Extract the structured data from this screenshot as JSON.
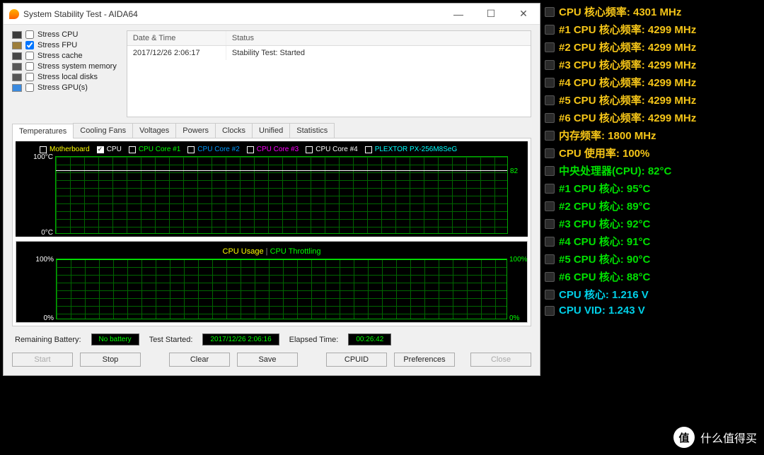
{
  "window": {
    "title": "System Stability Test - AIDA64",
    "minimize": "—",
    "maximize": "☐",
    "close": "✕"
  },
  "stress": {
    "cpu": "Stress CPU",
    "fpu": "Stress FPU",
    "cache": "Stress cache",
    "mem": "Stress system memory",
    "disk": "Stress local disks",
    "gpu": "Stress GPU(s)"
  },
  "status_table": {
    "h_date": "Date & Time",
    "h_status": "Status",
    "r_date": "2017/12/26 2:06:17",
    "r_status": "Stability Test: Started"
  },
  "tabs": [
    "Temperatures",
    "Cooling Fans",
    "Voltages",
    "Powers",
    "Clocks",
    "Unified",
    "Statistics"
  ],
  "temp_legend": {
    "mb": {
      "label": "Motherboard",
      "color": "#ff0",
      "checked": false
    },
    "cpu": {
      "label": "CPU",
      "color": "#fff",
      "checked": true
    },
    "c1": {
      "label": "CPU Core #1",
      "color": "#0f0",
      "checked": false
    },
    "c2": {
      "label": "CPU Core #2",
      "color": "#09f",
      "checked": false
    },
    "c3": {
      "label": "CPU Core #3",
      "color": "#f0f",
      "checked": false
    },
    "c4": {
      "label": "CPU Core #4",
      "color": "#fff",
      "checked": false
    },
    "ssd": {
      "label": "PLEXTOR PX-256M8SeG",
      "color": "#0ff",
      "checked": false
    }
  },
  "temp_chart": {
    "ymax": "100°C",
    "ymin": "0°C",
    "reading": "82"
  },
  "usage_title": {
    "a": "CPU Usage",
    "sep": "|",
    "b": "CPU Throttling"
  },
  "usage_chart": {
    "ymax": "100%",
    "ymin": "0%",
    "rmax": "100%",
    "rmin": "0%"
  },
  "statusbar": {
    "battery_lbl": "Remaining Battery:",
    "battery_val": "No battery",
    "started_lbl": "Test Started:",
    "started_val": "2017/12/26 2:06:16",
    "elapsed_lbl": "Elapsed Time:",
    "elapsed_val": "00:26:42"
  },
  "buttons": {
    "start": "Start",
    "stop": "Stop",
    "clear": "Clear",
    "save": "Save",
    "cpuid": "CPUID",
    "prefs": "Preferences",
    "close": "Close"
  },
  "gadget": {
    "cpu_core": "CPU 核心频率: 4301 MHz",
    "c1": "#1 CPU 核心频率: 4299 MHz",
    "c2": "#2 CPU 核心频率: 4299 MHz",
    "c3": "#3 CPU 核心频率: 4299 MHz",
    "c4": "#4 CPU 核心频率: 4299 MHz",
    "c5": "#5 CPU 核心频率: 4299 MHz",
    "c6": "#6 CPU 核心频率: 4299 MHz",
    "mem": "内存频率: 1800 MHz",
    "usage": "CPU 使用率: 100%",
    "cpu_temp": "中央处理器(CPU): 82°C",
    "t1": "#1 CPU 核心: 95°C",
    "t2": "#2 CPU 核心: 89°C",
    "t3": "#3 CPU 核心: 92°C",
    "t4": "#4 CPU 核心: 91°C",
    "t5": "#5 CPU 核心: 90°C",
    "t6": "#6 CPU 核心: 88°C",
    "vcore": "CPU 核心: 1.216 V",
    "vid": "CPU VID: 1.243 V"
  },
  "watermark": {
    "icon": "值",
    "text": "什么值得买"
  },
  "chart_data": {
    "type": "line",
    "title": "CPU Temperature",
    "ylabel": "°C",
    "ylim": [
      0,
      100
    ],
    "series": [
      {
        "name": "CPU",
        "values": [
          82,
          82,
          82,
          82,
          82,
          82,
          82,
          82,
          82,
          82
        ]
      }
    ]
  }
}
